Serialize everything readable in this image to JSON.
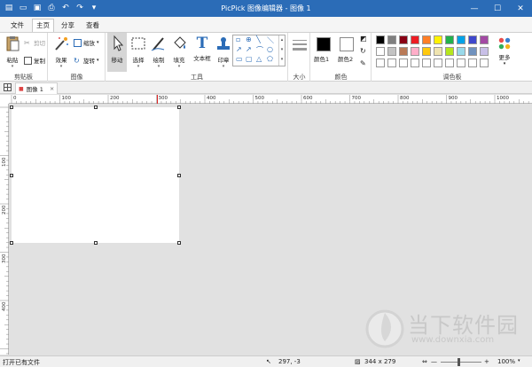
{
  "window": {
    "title": "PicPick 图像编辑器 - 图像 1",
    "qa_icons": [
      "new-file-icon",
      "open-folder-icon",
      "save-icon",
      "print-icon",
      "undo-icon",
      "redo-icon",
      "dropdown-icon"
    ]
  },
  "menu": {
    "tabs": [
      {
        "label": "文件",
        "active": false
      },
      {
        "label": "主页",
        "active": true
      },
      {
        "label": "分享",
        "active": false
      },
      {
        "label": "查看",
        "active": false
      }
    ]
  },
  "ribbon": {
    "clipboard": {
      "group_label": "剪贴板",
      "paste_label": "粘贴",
      "cut_label": "剪切",
      "copy_label": "复制"
    },
    "image": {
      "group_label": "图像",
      "effects_label": "效果",
      "resize_label": "缩放",
      "rotate_label": "旋转"
    },
    "tools": {
      "group_label": "工具",
      "move_label": "移动",
      "select_label": "选择",
      "draw_label": "绘制",
      "fill_label": "填充",
      "textbox_label": "文本框",
      "stamp_label": "印章"
    },
    "size": {
      "group_label": "大小"
    },
    "colors": {
      "group_label": "颜色",
      "color1_label": "颜色1",
      "color2_label": "颜色2",
      "color1": "#000000",
      "color2": "#ffffff"
    },
    "palette": {
      "group_label": "调色板",
      "more_label": "更多",
      "row1": [
        "#000000",
        "#7f7f7f",
        "#880015",
        "#ed1c24",
        "#ff7f27",
        "#fff200",
        "#22b14c",
        "#00a2e8",
        "#3f48cc",
        "#a349a4"
      ],
      "row2": [
        "#ffffff",
        "#c3c3c3",
        "#b97a57",
        "#ffaec9",
        "#ffc90e",
        "#efe4b0",
        "#b5e61d",
        "#99d9ea",
        "#7092be",
        "#c8bfe7"
      ],
      "row3": [
        "#ffffff",
        "#ffffff",
        "#ffffff",
        "#ffffff",
        "#ffffff",
        "#ffffff",
        "#ffffff",
        "#ffffff",
        "#ffffff",
        "#ffffff"
      ]
    }
  },
  "document": {
    "tab_label": "图像 1"
  },
  "ruler": {
    "h_labels": [
      "0",
      "100",
      "200",
      "300",
      "400",
      "500",
      "600",
      "700",
      "800",
      "900",
      "1000"
    ],
    "v_labels": [
      "100",
      "200",
      "300",
      "400"
    ]
  },
  "status": {
    "left_text": "打开已有文件",
    "coords": "297, -3",
    "image_size": "344 x 279",
    "zoom": "100%"
  },
  "watermark": {
    "cn": "当下软件园",
    "url": "www.downxia.com"
  }
}
